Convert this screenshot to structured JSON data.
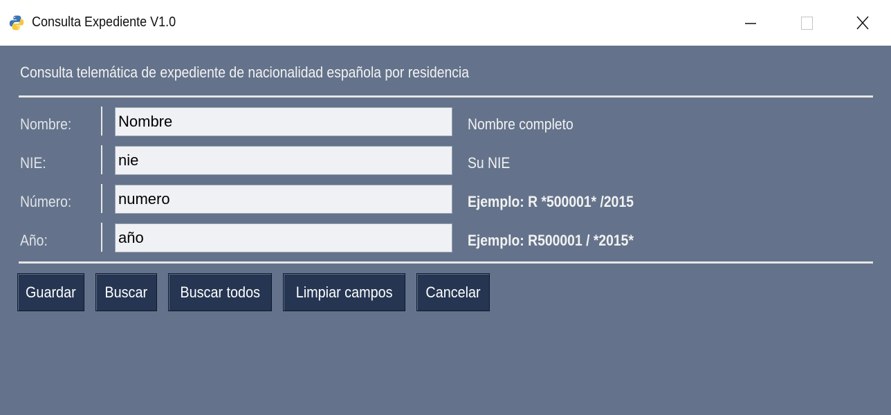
{
  "window": {
    "title": "Consulta Expediente V1.0",
    "app_icon": "python-icon",
    "controls": [
      "minimize-icon",
      "maximize-icon",
      "close-icon"
    ]
  },
  "header": {
    "text": "Consulta telemática de expediente de nacionalidad española por residencia"
  },
  "form": {
    "rows": [
      {
        "label": "Nombre:",
        "value": "Nombre",
        "hint": "Nombre completo"
      },
      {
        "label": "NIE:",
        "value": "nie",
        "hint": "Su NIE"
      },
      {
        "label": "Número:",
        "value": "numero",
        "hint": "Ejemplo: R *500001* /2015"
      },
      {
        "label": "Año:",
        "value": "año",
        "hint": "Ejemplo: R500001 / *2015*"
      }
    ]
  },
  "buttons": {
    "guardar": "Guardar",
    "buscar": "Buscar",
    "buscar_todos": "Buscar todos",
    "limpiar": "Limpiar campos",
    "cancelar": "Cancelar"
  },
  "colors": {
    "background": "#64738b",
    "button": "#253552",
    "field": "#f0f1f5"
  }
}
